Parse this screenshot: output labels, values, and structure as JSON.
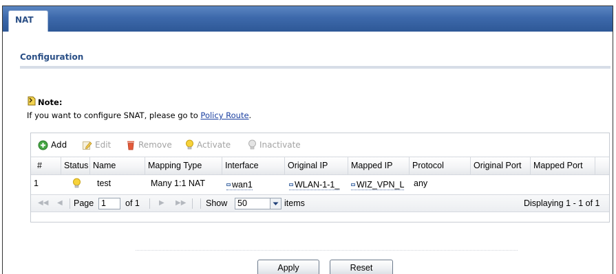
{
  "tab": {
    "label": "NAT"
  },
  "section": {
    "title": "Configuration"
  },
  "note": {
    "label": "Note:",
    "text_before": "If you want to configure SNAT, please go to ",
    "link": "Policy Route",
    "text_after": "."
  },
  "toolbar": {
    "add": "Add",
    "edit": "Edit",
    "remove": "Remove",
    "activate": "Activate",
    "inactivate": "Inactivate"
  },
  "table": {
    "columns": [
      "#",
      "Status",
      "Name",
      "Mapping Type",
      "Interface",
      "Original IP",
      "Mapped IP",
      "Protocol",
      "Original Port",
      "Mapped Port"
    ],
    "rows": [
      {
        "index": "1",
        "status": "active-bulb",
        "name": "test",
        "mapping_type": "Many 1:1 NAT",
        "interface": "wan1",
        "original_ip": "WLAN-1-1_",
        "mapped_ip": "WIZ_VPN_L",
        "protocol": "any",
        "original_port": "",
        "mapped_port": ""
      }
    ]
  },
  "pager": {
    "page_label": "Page",
    "page_value": "1",
    "of_label": "of 1",
    "show_label": "Show",
    "show_value": "50",
    "items_label": "items",
    "displaying": "Displaying 1 - 1 of 1"
  },
  "buttons": {
    "apply": "Apply",
    "reset": "Reset"
  },
  "colors": {
    "tab_bar": "#3d69ab",
    "title": "#2a4f86",
    "link": "#1a3fa0"
  }
}
